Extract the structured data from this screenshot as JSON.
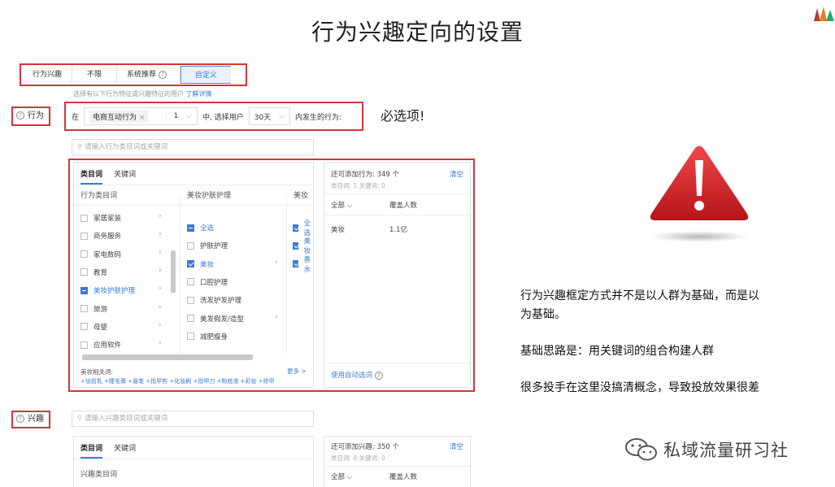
{
  "slide": {
    "title": "行为兴趣定向的设置"
  },
  "mode_selector": {
    "label": "行为兴趣",
    "options": [
      "不限",
      "系统推荐",
      "自定义"
    ],
    "selected": "自定义",
    "hint": "选择有以下行为特征或兴趣特征的用户",
    "hint_link": "了解详情"
  },
  "behavior": {
    "section_label": "行为",
    "prefix": "在",
    "scene_tag": "电商互动行为",
    "scene_count": "1",
    "middle_text": "中, 选择用户",
    "days": "30天",
    "suffix": "内发生的行为:",
    "required_note": "必选项!",
    "search_placeholder": "请输入行为类目词或关键词",
    "tabs": [
      "类目词",
      "关键词"
    ],
    "col1_header": "行为类目词",
    "col2_header": "美妆护肤护理",
    "col3_header": "美妆",
    "col1_items": [
      {
        "label": "家居家装",
        "state": "none",
        "active": false
      },
      {
        "label": "商务服务",
        "state": "none",
        "active": false
      },
      {
        "label": "家电数码",
        "state": "none",
        "active": false
      },
      {
        "label": "教育",
        "state": "none",
        "active": false
      },
      {
        "label": "美妆护肤护理",
        "state": "half",
        "active": true
      },
      {
        "label": "旅游",
        "state": "none",
        "active": false
      },
      {
        "label": "母婴",
        "state": "none",
        "active": false
      },
      {
        "label": "应用软件",
        "state": "none",
        "active": false
      }
    ],
    "col2_items": [
      {
        "label": "全选",
        "state": "half",
        "active": true
      },
      {
        "label": "护肤护理",
        "state": "none",
        "active": false
      },
      {
        "label": "美妆",
        "state": "on",
        "active": true
      },
      {
        "label": "口腔护理",
        "state": "none",
        "active": false
      },
      {
        "label": "洗发护发护理",
        "state": "none",
        "active": false
      },
      {
        "label": "美发假发/造型",
        "state": "none",
        "active": false
      },
      {
        "label": "减肥瘦身",
        "state": "none",
        "active": false
      }
    ],
    "col3_items": [
      "全选",
      "美妆",
      "香水"
    ],
    "related_label": "美妆相关词:",
    "more_label": "更多 >",
    "related_keywords": "+妆前乳 +睫毛膏 +眉笔 +指甲剪 +化妆刷 +指甲刀 +粉底液 +彩妆 +修甲",
    "capacity": "还可添加行为:   349 个",
    "clear": "清空",
    "counts": "类目词: 1     关键词: 0",
    "table_headers": [
      "全部 ⌵",
      "覆盖人数"
    ],
    "table_rows": [
      {
        "name": "美妆",
        "value": "1.1亿"
      }
    ],
    "auto_select": "使用自动选词"
  },
  "interest": {
    "section_label": "兴趣",
    "search_placeholder": "请输入兴趣类目词或关键词",
    "tabs": [
      "类目词",
      "关键词"
    ],
    "col1_header": "兴趣类目词",
    "capacity": "还可添加兴趣:   350 个",
    "clear": "清空",
    "counts": "类目词: 0     关键词: 0",
    "table_headers": [
      "全部 ⌵",
      "覆盖人数"
    ]
  },
  "notes": {
    "line1a": "行为兴趣框定方式并不是以人群为基础，而是以",
    "line1b": "为基础。",
    "line2": "基础思路是：用关键词的组合构建人群",
    "line3": "很多投手在这里没搞清概念，导致投放效果很差"
  },
  "watermark": "私域流量研习社",
  "colors": {
    "highlight_box": "#d9323a",
    "accent": "#3a7bd5",
    "warning": "#d9232b"
  },
  "icons": [
    "warning-icon",
    "wechat-icon",
    "help-icon",
    "chevron-right-icon",
    "close-icon"
  ]
}
